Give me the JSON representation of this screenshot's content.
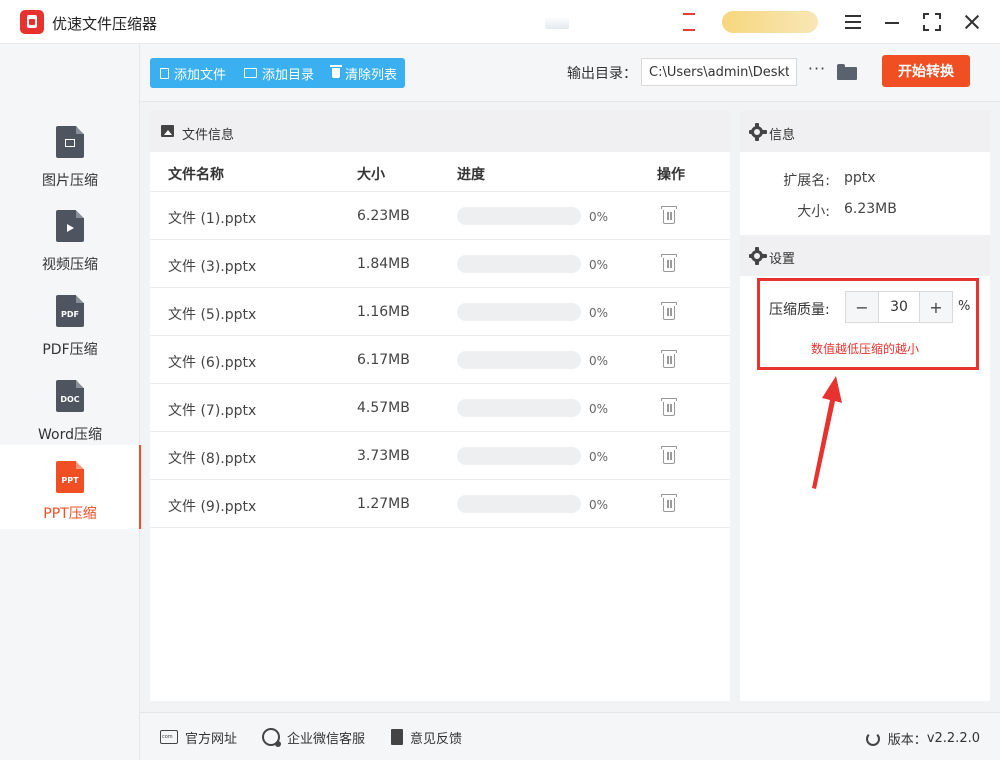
{
  "app": {
    "title": "优速文件压缩器"
  },
  "sidebar": {
    "items": [
      {
        "label": "图片压缩",
        "glyph": "",
        "icon": "image-file-icon",
        "active": false
      },
      {
        "label": "视频压缩",
        "glyph": "",
        "icon": "video-file-icon",
        "active": false
      },
      {
        "label": "PDF压缩",
        "glyph": "PDF",
        "icon": "pdf-file-icon",
        "active": false
      },
      {
        "label": "Word压缩",
        "glyph": "DOC",
        "icon": "doc-file-icon",
        "active": false
      },
      {
        "label": "PPT压缩",
        "glyph": "PPT",
        "icon": "ppt-file-icon",
        "active": true
      }
    ]
  },
  "toolbar": {
    "add_file": "添加文件",
    "add_dir": "添加目录",
    "clear_list": "清除列表",
    "output_label": "输出目录：",
    "output_value": "C:\\Users\\admin\\Desktop",
    "more": "···",
    "start": "开始转换"
  },
  "file_panel": {
    "title": "文件信息",
    "columns": {
      "name": "文件名称",
      "size": "大小",
      "progress": "进度",
      "action": "操作"
    },
    "rows": [
      {
        "name": "文件 (1).pptx",
        "size": "6.23MB",
        "progress": 0,
        "pct": "0%"
      },
      {
        "name": "文件 (3).pptx",
        "size": "1.84MB",
        "progress": 0,
        "pct": "0%"
      },
      {
        "name": "文件 (5).pptx",
        "size": "1.16MB",
        "progress": 0,
        "pct": "0%"
      },
      {
        "name": "文件 (6).pptx",
        "size": "6.17MB",
        "progress": 0,
        "pct": "0%"
      },
      {
        "name": "文件 (7).pptx",
        "size": "4.57MB",
        "progress": 0,
        "pct": "0%"
      },
      {
        "name": "文件 (8).pptx",
        "size": "3.73MB",
        "progress": 0,
        "pct": "0%"
      },
      {
        "name": "文件 (9).pptx",
        "size": "1.27MB",
        "progress": 0,
        "pct": "0%"
      }
    ]
  },
  "info_panel": {
    "info_title": "信息",
    "ext_label": "扩展名:",
    "ext_value": "pptx",
    "size_label": "大小:",
    "size_value": "6.23MB",
    "settings_title": "设置",
    "quality_label": "压缩质量:",
    "minus": "−",
    "quality_value": "30",
    "plus": "+",
    "unit": "%",
    "hint": "数值越低压缩的越小"
  },
  "footer": {
    "website": "官方网址",
    "wechat": "企业微信客服",
    "feedback": "意见反馈",
    "version_label": "版本：",
    "version_value": "v2.2.2.0"
  },
  "colors": {
    "accent": "#f04e23",
    "primary": "#3ab0f0",
    "highlight": "#e8322f"
  }
}
